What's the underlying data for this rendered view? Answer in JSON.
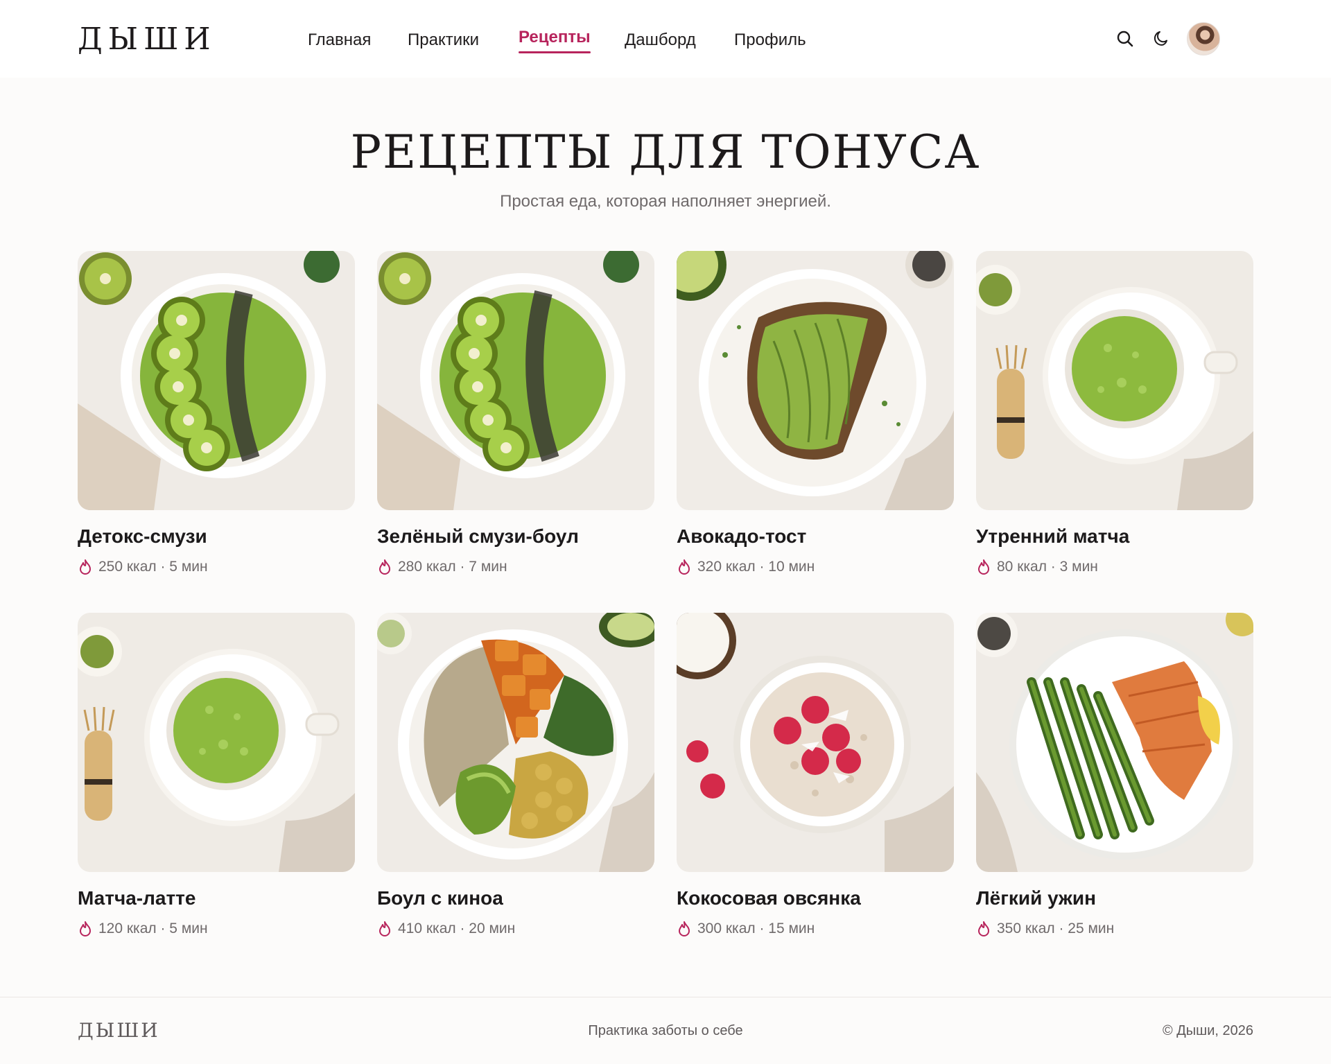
{
  "header": {
    "logo": "ДЫШИ",
    "nav": [
      {
        "label": "Главная"
      },
      {
        "label": "Практики"
      },
      {
        "label": "Рецепты",
        "active": true
      },
      {
        "label": "Дашборд"
      },
      {
        "label": "Профиль"
      }
    ],
    "icons": [
      "search-icon",
      "moon-icon"
    ]
  },
  "hero": {
    "title": "РЕЦЕПТЫ ДЛЯ ТОНУСА",
    "subtitle": "Простая еда, которая наполняет энергией."
  },
  "recipes": [
    {
      "title": "Детокс-смузи",
      "meta": "250 ккал · 5 мин",
      "image": "smoothie-bowl-kiwi"
    },
    {
      "title": "Зелёный смузи-боул",
      "meta": "280 ккал · 7 мин",
      "image": "smoothie-bowl-kiwi"
    },
    {
      "title": "Авокадо-тост",
      "meta": "320 ккал · 10 мин",
      "image": "avocado-toast"
    },
    {
      "title": "Утренний матча",
      "meta": "80 ккал · 3 мин",
      "image": "matcha-cup"
    },
    {
      "title": "Матча-латте",
      "meta": "120 ккал · 5 мин",
      "image": "matcha-cup"
    },
    {
      "title": "Боул с киноа",
      "meta": "410 ккал · 20 мин",
      "image": "quinoa-bowl"
    },
    {
      "title": "Кокосовая овсянка",
      "meta": "300 ккал · 15 мин",
      "image": "oatmeal-raspberry"
    },
    {
      "title": "Лёгкий ужин",
      "meta": "350 ккал · 25 мин",
      "image": "salmon-asparagus"
    }
  ],
  "footer": {
    "logo": "ДЫШИ",
    "tagline": "Практика заботы о себе",
    "copyright": "© Дыши, 2026"
  },
  "colors": {
    "accent": "#b7245c",
    "background": "#fcfbfa",
    "text": "#1c1a1b",
    "muted": "#6f6a6b"
  }
}
